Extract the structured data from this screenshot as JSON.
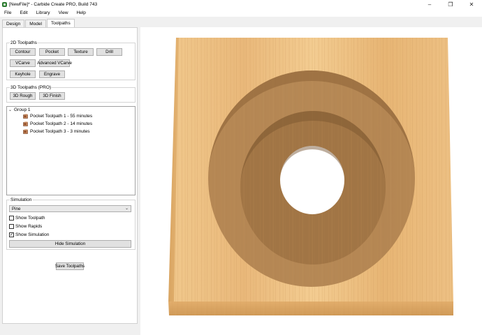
{
  "window": {
    "title": "[NewFile]* - Carbide Create PRO, Build 743",
    "controls": [
      "–",
      "❐",
      "✕"
    ]
  },
  "menu": [
    "File",
    "Edit",
    "Library",
    "View",
    "Help"
  ],
  "tabs": [
    {
      "label": "Design",
      "active": false
    },
    {
      "label": "Model",
      "active": false
    },
    {
      "label": "Toolpaths",
      "active": true
    }
  ],
  "toolpaths_2d": {
    "title": "2D Toolpaths",
    "buttons": [
      "Contour",
      "Pocket",
      "Texture",
      "Drill",
      "VCarve",
      "Advanced VCarve",
      "Keyhole",
      "Engrave"
    ]
  },
  "toolpaths_3d": {
    "title": "3D Toolpaths (PRO)",
    "buttons": [
      "3D Rough",
      "3D Finish"
    ]
  },
  "tree": {
    "group_label": "Group 1",
    "items": [
      "Pocket Toolpath 1 - 55 minutes",
      "Pocket Toolpath 2 - 14 minutes",
      "Pocket Toolpath 3 - 3 minutes"
    ]
  },
  "simulation": {
    "title": "Simulation",
    "material": "Pine",
    "show_toolpath": {
      "label": "Show Toolpath",
      "checked": false
    },
    "show_rapids": {
      "label": "Show Rapids",
      "checked": false
    },
    "show_simulation": {
      "label": "Show Simulation",
      "checked": true
    },
    "hide_button": "Hide Simulation"
  },
  "save_button": "Save Toolpaths",
  "colors": {
    "wood_light": "#f2c88a",
    "wood_mid": "#e0ad6a",
    "wood_dark": "#c38d4f",
    "pocket": "#a77d47",
    "pocket_deep": "#8f6839"
  }
}
